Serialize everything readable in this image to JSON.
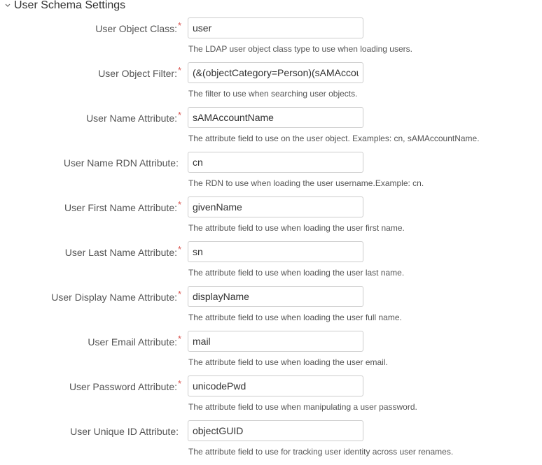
{
  "section": {
    "title": "User Schema Settings",
    "toggle_icon": "chevron-down-icon"
  },
  "fields": [
    {
      "label": "User Object Class:",
      "required": true,
      "value": "user",
      "help": "The LDAP user object class type to use when loading users."
    },
    {
      "label": "User Object Filter:",
      "required": true,
      "value": "(&(objectCategory=Person)(sAMAccountName=*))",
      "help": "The filter to use when searching user objects."
    },
    {
      "label": "User Name Attribute:",
      "required": true,
      "value": "sAMAccountName",
      "help": "The attribute field to use on the user object. Examples: cn, sAMAccountName."
    },
    {
      "label": "User Name RDN Attribute:",
      "required": false,
      "value": "cn",
      "help": "The RDN to use when loading the user username.Example: cn."
    },
    {
      "label": "User First Name Attribute:",
      "required": true,
      "value": "givenName",
      "help": "The attribute field to use when loading the user first name."
    },
    {
      "label": "User Last Name Attribute:",
      "required": true,
      "value": "sn",
      "help": "The attribute field to use when loading the user last name."
    },
    {
      "label": "User Display Name Attribute:",
      "required": true,
      "value": "displayName",
      "help": "The attribute field to use when loading the user full name."
    },
    {
      "label": "User Email Attribute:",
      "required": true,
      "value": "mail",
      "help": "The attribute field to use when loading the user email."
    },
    {
      "label": "User Password Attribute:",
      "required": true,
      "value": "unicodePwd",
      "help": "The attribute field to use when manipulating a user password."
    },
    {
      "label": "User Unique ID Attribute:",
      "required": false,
      "value": "objectGUID",
      "help": "The attribute field to use for tracking user identity across user renames."
    }
  ],
  "required_marker": "*",
  "colors": {
    "required": "#d9534f",
    "border": "#cccccc",
    "label": "#555555"
  }
}
